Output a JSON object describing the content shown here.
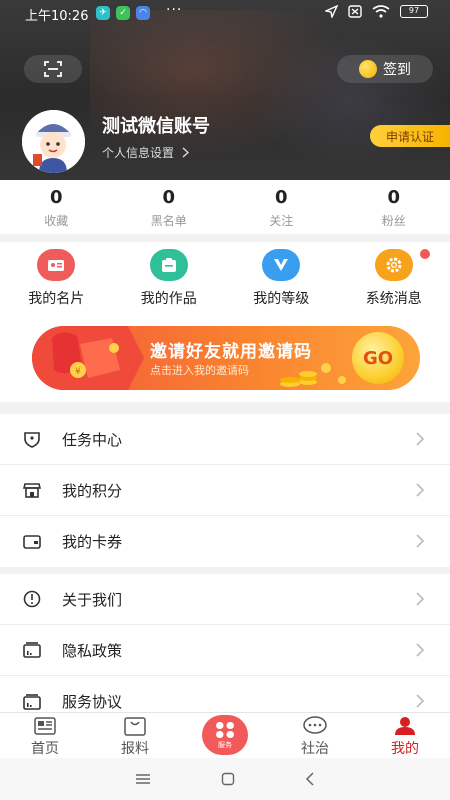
{
  "status": {
    "time": "上午10:26",
    "more": "···",
    "battery": "97"
  },
  "header": {
    "signin_label": "签到",
    "username": "测试微信账号",
    "profile_link": "个人信息设置",
    "certify_label": "申请认证"
  },
  "stats": [
    {
      "value": "0",
      "label": "收藏"
    },
    {
      "value": "0",
      "label": "黑名单"
    },
    {
      "value": "0",
      "label": "关注"
    },
    {
      "value": "0",
      "label": "粉丝"
    }
  ],
  "quick": [
    {
      "label": "我的名片",
      "icon": "id-card-icon",
      "color": "#f05b5b"
    },
    {
      "label": "我的作品",
      "icon": "briefcase-icon",
      "color": "#2fc09a"
    },
    {
      "label": "我的等级",
      "icon": "v-badge-icon",
      "color": "#3a9ef0"
    },
    {
      "label": "系统消息",
      "icon": "gear-icon",
      "color": "#f7a21b"
    }
  ],
  "banner": {
    "title": "邀请好友就用邀请码",
    "subtitle": "点击进入我的邀请码",
    "go": "GO"
  },
  "menu1": [
    {
      "label": "任务中心",
      "icon": "shield-icon"
    },
    {
      "label": "我的积分",
      "icon": "store-icon"
    },
    {
      "label": "我的卡券",
      "icon": "wallet-icon"
    }
  ],
  "menu2": [
    {
      "label": "关于我们",
      "icon": "info-icon"
    },
    {
      "label": "隐私政策",
      "icon": "document-icon"
    },
    {
      "label": "服务协议",
      "icon": "agreement-icon"
    }
  ],
  "tabs": [
    {
      "label": "首页",
      "icon": "home-news-icon"
    },
    {
      "label": "报料",
      "icon": "bag-icon"
    },
    {
      "label": "服务",
      "icon": "grid-icon"
    },
    {
      "label": "社治",
      "icon": "chat-icon"
    },
    {
      "label": "我的",
      "icon": "user-icon"
    }
  ],
  "colors": {
    "accent": "#d81e1e",
    "certify": "#f6b400"
  }
}
